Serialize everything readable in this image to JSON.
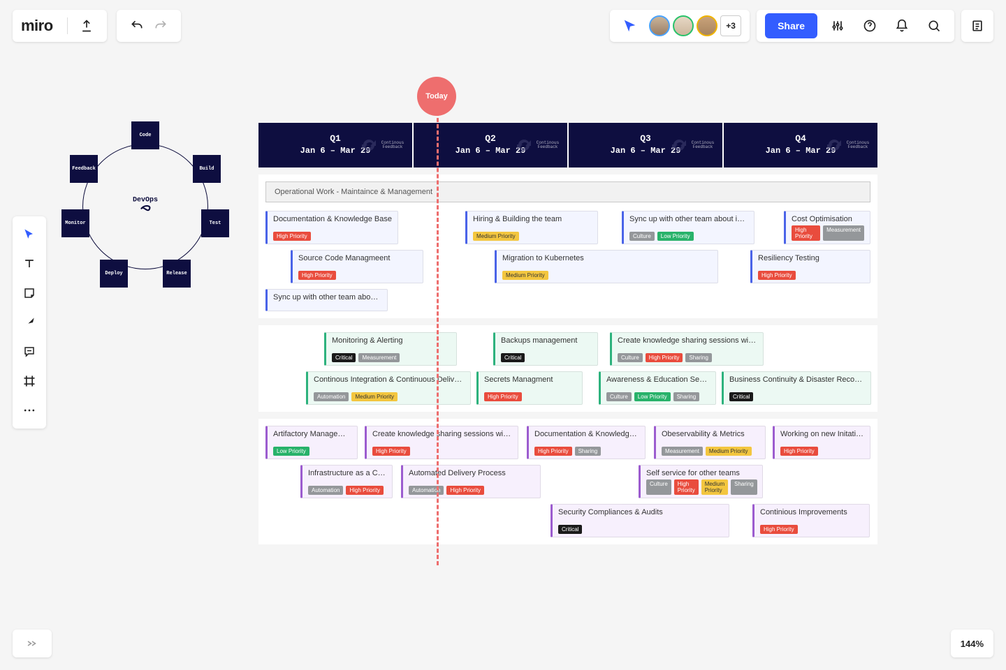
{
  "brand": "miro",
  "topbar": {
    "more_avatars": "+3",
    "share": "Share"
  },
  "today": "Today",
  "zoom": "144%",
  "devops": {
    "center_label": "DevOps",
    "nodes": [
      "Code",
      "Build",
      "Test",
      "Release",
      "Deploy",
      "Monitor",
      "Feedback"
    ]
  },
  "quarters": [
    {
      "name": "Q1",
      "dates": "Jan 6 – Mar 29",
      "cf": "Continous Feedback"
    },
    {
      "name": "Q2",
      "dates": "Jan 6 – Mar 29",
      "cf": "Continous Feedback"
    },
    {
      "name": "Q3",
      "dates": "Jan 6 – Mar 29",
      "cf": "Continous Feedback"
    },
    {
      "name": "Q4",
      "dates": "Jan 6 – Mar 29",
      "cf": "Continous Feedback"
    }
  ],
  "ops_bar": "Operational Work - Maintaince & Management",
  "tags": {
    "high": "High Priority",
    "medium": "Medium Priority",
    "low": "Low Priority",
    "critical": "Critical",
    "measurement": "Measurement",
    "culture": "Culture",
    "automation": "Automation",
    "sharing": "Sharing"
  },
  "cards": {
    "doc_kb": "Documentation & Knowledge Base",
    "hiring": "Hiring & Building the team",
    "sync_other": "Sync up with other team about intiatives",
    "cost_opt": "Cost Optimisation",
    "src_code": "Source Code Managmeent",
    "migration": "Migration to Kubernetes",
    "resiliency": "Resiliency Testing",
    "sync_other2": "Sync up with other team about intiatives",
    "mon_alert": "Monitoring & Alerting",
    "backups": "Backups management",
    "know_share": "Create knowledge sharing sessions with other teams",
    "cicd": "Continous Integration & Continuous Delivery",
    "secrets": "Secrets Managment",
    "aware": "Awareness & Education Sesions",
    "bcdr": "Business Continuity & Disaster Recovery",
    "artifactory": "Artifactory Management",
    "know_share2": "Create knowledge sharing sessions with other teams",
    "doc_kb2": "Documentation & Knowledge Base",
    "obs": "Obeservability & Metrics",
    "newinit": "Working on new Initatives & Ideas",
    "iac": "Infrastructure as a Code",
    "auto_delivery": "Automated Delivery Process",
    "selfsvc": "Self service for other teams",
    "sec_audit": "Security Compliances & Audits",
    "cont_imp": "Continious Improvements"
  }
}
